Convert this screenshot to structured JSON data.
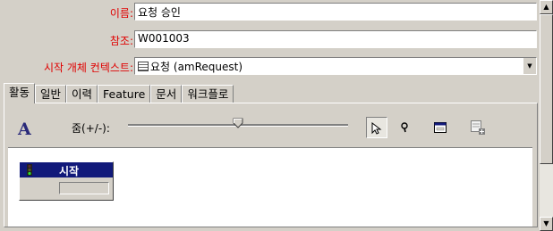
{
  "form": {
    "name_label": "이름:",
    "name_value": "요청 승인",
    "ref_label": "참조:",
    "ref_value": "W001003",
    "context_label": "시작 개체 컨텍스트:",
    "context_value": "요청 (amRequest)"
  },
  "tabs": [
    {
      "label": "활동",
      "active": true
    },
    {
      "label": "일반",
      "active": false
    },
    {
      "label": "이력",
      "active": false
    },
    {
      "label": "Feature",
      "active": false
    },
    {
      "label": "문서",
      "active": false
    },
    {
      "label": "워크플로",
      "active": false
    }
  ],
  "toolbar": {
    "font_glyph": "A",
    "zoom_label": "줌(+/-):",
    "zoom_level": 0.5
  },
  "workflow": {
    "start_node_title": "시작"
  },
  "colors": {
    "label_red": "#e00000",
    "node_header": "#11197a",
    "face": "#d4d0c8"
  }
}
